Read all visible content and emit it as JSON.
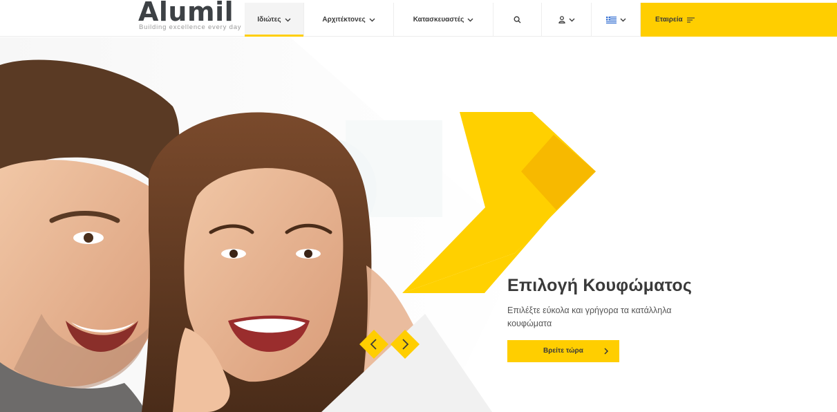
{
  "brand": {
    "logo_text": "Alumil",
    "tagline": "Building excellence every day",
    "accent_color": "#ffce00"
  },
  "nav": {
    "items": [
      {
        "label": "Ιδιώτες",
        "active": true
      },
      {
        "label": "Αρχιτέκτονες",
        "active": false
      },
      {
        "label": "Κατασκευαστές",
        "active": false
      }
    ],
    "search_icon": "search-icon",
    "user_icon": "user-icon",
    "language_icon": "greek-flag-icon",
    "company_label": "Εταιρεία",
    "company_icon": "menu-lines-icon"
  },
  "hero": {
    "title": "Επιλογή Κουφώματος",
    "subtitle": "Επιλέξτε εύκολα και γρήγορα τα κατάλληλα κουφώματα",
    "cta_label": "Βρείτε τώρα",
    "prev_icon": "chevron-left-icon",
    "next_icon": "chevron-right-icon"
  }
}
